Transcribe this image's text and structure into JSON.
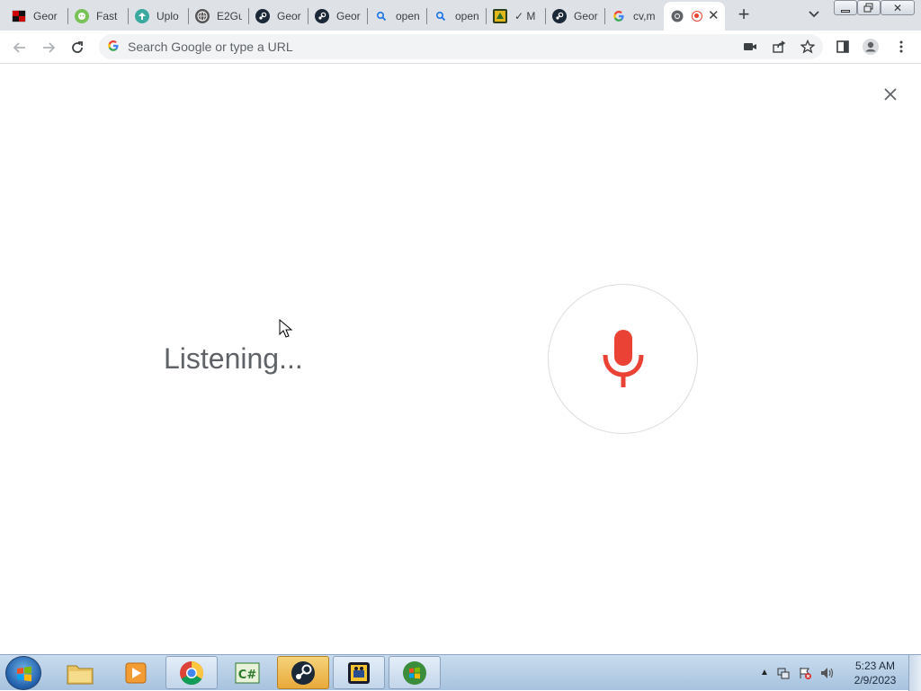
{
  "tabs": [
    {
      "title": "Geor",
      "icon": "flag-icon"
    },
    {
      "title": "Fast",
      "icon": "android-icon"
    },
    {
      "title": "Uplo",
      "icon": "upload-icon"
    },
    {
      "title": "E2Gu",
      "icon": "globe-icon"
    },
    {
      "title": "Geor",
      "icon": "steam-icon"
    },
    {
      "title": "Geor",
      "icon": "steam-icon"
    },
    {
      "title": "open",
      "icon": "search-icon"
    },
    {
      "title": "open",
      "icon": "search-icon"
    },
    {
      "title": "✓ M",
      "icon": "game-icon"
    },
    {
      "title": "Geor",
      "icon": "steam-icon"
    },
    {
      "title": "cv,m",
      "icon": "google-icon"
    }
  ],
  "active_tab": {
    "icon": "chrome-icon",
    "recording": true
  },
  "omnibox": {
    "placeholder": "Search Google or type a URL",
    "value": ""
  },
  "main": {
    "status_text": "Listening..."
  },
  "taskbar": {
    "clock_time": "5:23 AM",
    "clock_date": "2/9/2023",
    "apps": [
      "explorer",
      "media-player",
      "chrome",
      "csharp",
      "steam",
      "game",
      "windows-logo"
    ]
  },
  "colors": {
    "mic_red": "#ea4335",
    "tabstrip": "#dee1e6",
    "listening_text": "#5f6368"
  }
}
